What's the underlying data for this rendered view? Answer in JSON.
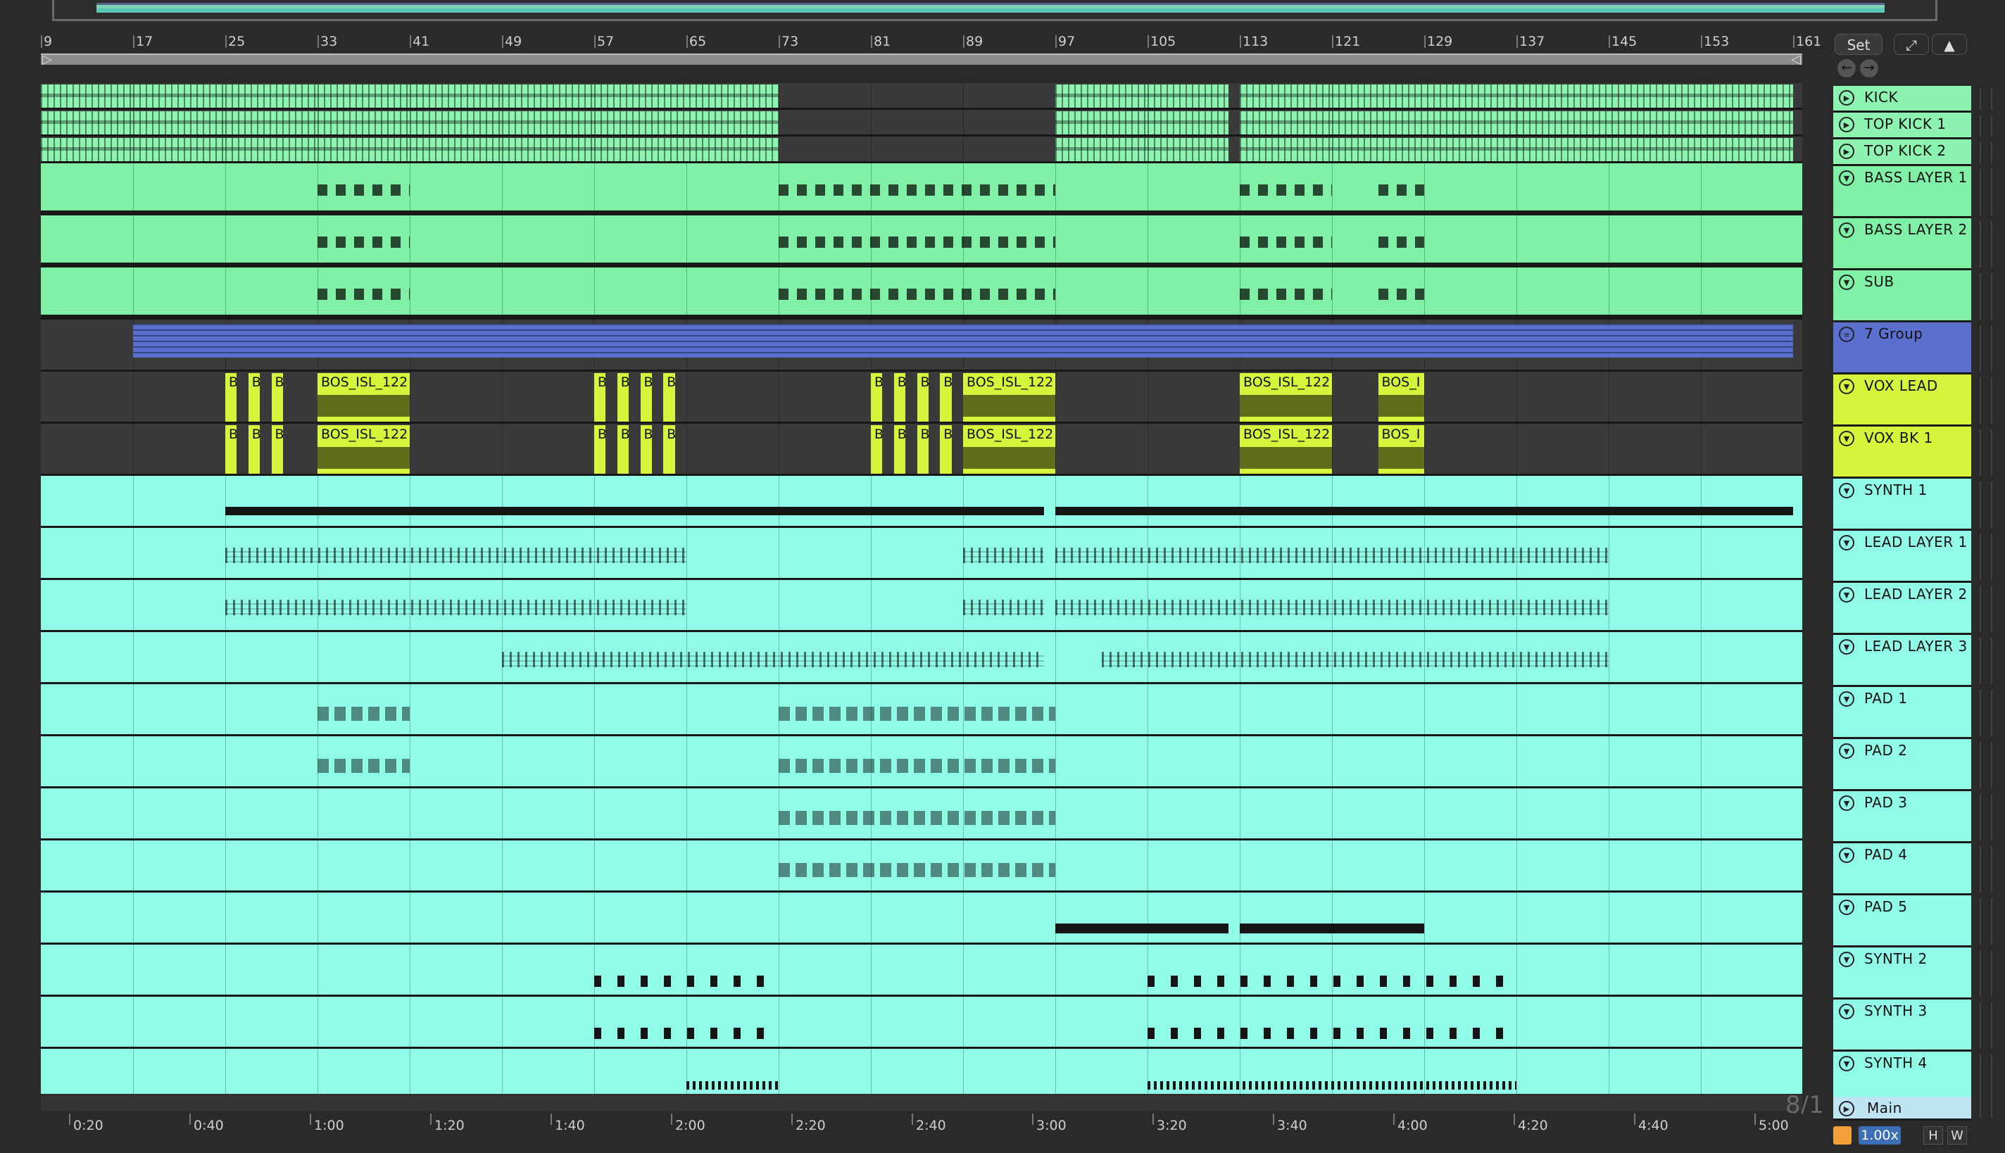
{
  "ruler": {
    "bars": [
      "9",
      "17",
      "25",
      "33",
      "41",
      "49",
      "57",
      "65",
      "73",
      "81",
      "89",
      "97",
      "105",
      "113",
      "121",
      "129",
      "137",
      "145",
      "153",
      "161"
    ]
  },
  "time_ruler": {
    "labels": [
      "0:20",
      "0:40",
      "1:00",
      "1:20",
      "1:40",
      "2:00",
      "2:20",
      "2:40",
      "3:00",
      "3:20",
      "3:40",
      "4:00",
      "4:20",
      "4:40",
      "5:00"
    ]
  },
  "controls": {
    "set_label": "Set",
    "zoom": "1.00x",
    "h_label": "H",
    "w_label": "W",
    "time_signature": "8/1"
  },
  "colors": {
    "kick": "#8cf3b0",
    "bass": "#7ff0a5",
    "group": "#5b6fcf",
    "vox": "#d4f53c",
    "synth": "#90fce8",
    "main": "#bfe5f2"
  },
  "tracks": [
    {
      "name": "KICK",
      "icon": "play-icon",
      "color": "#8cf3b0"
    },
    {
      "name": "TOP KICK 1",
      "icon": "play-icon",
      "color": "#8cf3b0"
    },
    {
      "name": "TOP KICK 2",
      "icon": "play-icon",
      "color": "#8cf3b0"
    },
    {
      "name": "BASS LAYER 1",
      "icon": "chevron-down-icon",
      "color": "#7ff0a5"
    },
    {
      "name": "BASS LAYER 2",
      "icon": "chevron-down-icon",
      "color": "#7ff0a5"
    },
    {
      "name": "SUB",
      "icon": "chevron-down-icon",
      "color": "#7ff0a5"
    },
    {
      "name": "7 Group",
      "icon": "list-icon",
      "color": "#5b6fcf"
    },
    {
      "name": "VOX LEAD",
      "icon": "chevron-down-icon",
      "color": "#d4f53c"
    },
    {
      "name": "VOX BK 1",
      "icon": "chevron-down-icon",
      "color": "#d4f53c"
    },
    {
      "name": "SYNTH 1",
      "icon": "chevron-down-icon",
      "color": "#90fce8"
    },
    {
      "name": "LEAD LAYER 1",
      "icon": "chevron-down-icon",
      "color": "#90fce8"
    },
    {
      "name": "LEAD LAYER 2",
      "icon": "chevron-down-icon",
      "color": "#90fce8"
    },
    {
      "name": "LEAD LAYER 3",
      "icon": "chevron-down-icon",
      "color": "#90fce8"
    },
    {
      "name": "PAD 1",
      "icon": "chevron-down-icon",
      "color": "#90fce8"
    },
    {
      "name": "PAD 2",
      "icon": "chevron-down-icon",
      "color": "#90fce8"
    },
    {
      "name": "PAD 3",
      "icon": "chevron-down-icon",
      "color": "#90fce8"
    },
    {
      "name": "PAD 4",
      "icon": "chevron-down-icon",
      "color": "#90fce8"
    },
    {
      "name": "PAD 5",
      "icon": "chevron-down-icon",
      "color": "#90fce8"
    },
    {
      "name": "SYNTH 2",
      "icon": "chevron-down-icon",
      "color": "#90fce8"
    },
    {
      "name": "SYNTH 3",
      "icon": "chevron-down-icon",
      "color": "#90fce8"
    },
    {
      "name": "SYNTH 4",
      "icon": "chevron-down-icon",
      "color": "#90fce8"
    },
    {
      "name": "Main",
      "icon": "play-icon",
      "color": "#bfe5f2"
    }
  ],
  "clip_names": {
    "vox_long": "BOS_ISL_122",
    "vox_short": "BOS_I",
    "vox_tiny": "B"
  }
}
